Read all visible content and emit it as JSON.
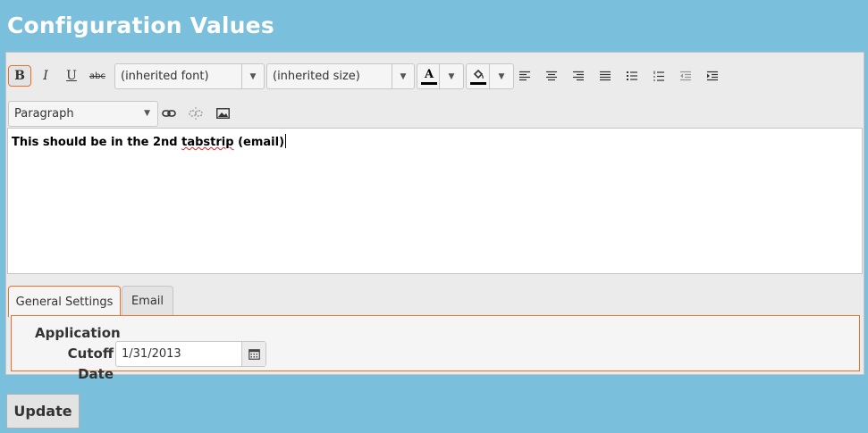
{
  "page": {
    "title": "Configuration Values"
  },
  "toolbar": {
    "bold": "B",
    "italic": "I",
    "underline": "U",
    "strikethrough": "abc",
    "font_name": "(inherited font)",
    "font_size": "(inherited size)",
    "fore_color_glyph": "A",
    "fore_color": "#000000",
    "back_color": "#000000",
    "format_block": "Paragraph",
    "icons": [
      "bold-icon",
      "italic-icon",
      "underline-icon",
      "strikethrough-icon",
      "font-color-icon",
      "background-color-icon",
      "align-left-icon",
      "align-center-icon",
      "align-right-icon",
      "justify-icon",
      "bullet-list-icon",
      "numbered-list-icon",
      "outdent-icon",
      "indent-icon",
      "link-icon",
      "unlink-icon",
      "image-icon"
    ]
  },
  "editor": {
    "text_before": "This should be in the 2nd ",
    "text_misspelled": "tabstrip",
    "text_after": " (email)"
  },
  "tabs": [
    {
      "label": "General Settings",
      "active": true
    },
    {
      "label": "Email",
      "active": false
    }
  ],
  "general": {
    "cutoff_label": "Application Cutoff Date",
    "cutoff_value": "1/31/2013"
  },
  "actions": {
    "update_label": "Update"
  },
  "colors": {
    "page_bg": "#7abfdb",
    "accent": "#e9702d"
  }
}
